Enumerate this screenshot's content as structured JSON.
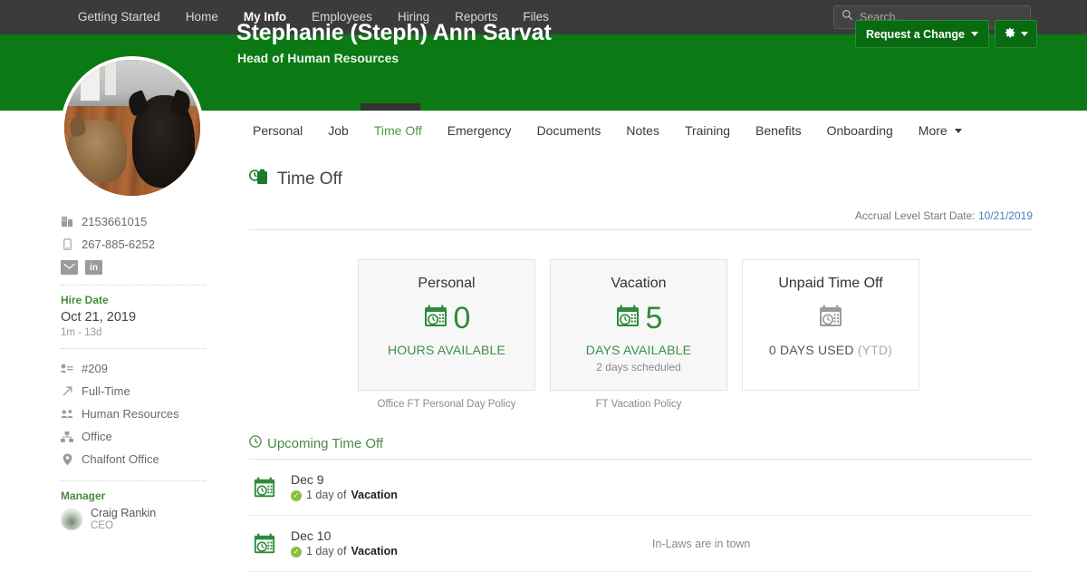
{
  "topnav": {
    "items": [
      {
        "label": "Getting Started",
        "active": false
      },
      {
        "label": "Home",
        "active": false
      },
      {
        "label": "My Info",
        "active": true
      },
      {
        "label": "Employees",
        "active": false
      },
      {
        "label": "Hiring",
        "active": false
      },
      {
        "label": "Reports",
        "active": false
      },
      {
        "label": "Files",
        "active": false
      }
    ],
    "search_placeholder": "Search..."
  },
  "header": {
    "employee_name": "Stephanie (Steph) Ann Sarvat",
    "employee_title": "Head of Human Resources",
    "request_change_label": "Request a Change",
    "accent_green": "#0b7a14"
  },
  "sidebar": {
    "work_phone": "2153661015",
    "mobile_phone": "267-885-6252",
    "email_icon_label": "✉",
    "linkedin_icon_label": "in",
    "hire_date_label": "Hire Date",
    "hire_date_value": "Oct 21, 2019",
    "hire_date_tenure": "1m - 13d",
    "employee_id": "#209",
    "employment_type": "Full-Time",
    "department": "Human Resources",
    "division": "Office",
    "location": "Chalfont Office",
    "manager_label": "Manager",
    "manager_name": "Craig Rankin",
    "manager_role": "CEO"
  },
  "tabs": [
    {
      "label": "Personal",
      "active": false,
      "caret": false
    },
    {
      "label": "Job",
      "active": false,
      "caret": false
    },
    {
      "label": "Time Off",
      "active": true,
      "caret": false
    },
    {
      "label": "Emergency",
      "active": false,
      "caret": false
    },
    {
      "label": "Documents",
      "active": false,
      "caret": false
    },
    {
      "label": "Notes",
      "active": false,
      "caret": false
    },
    {
      "label": "Training",
      "active": false,
      "caret": false
    },
    {
      "label": "Benefits",
      "active": false,
      "caret": false
    },
    {
      "label": "Onboarding",
      "active": false,
      "caret": false
    },
    {
      "label": "More",
      "active": false,
      "caret": true
    }
  ],
  "main": {
    "section_title": "Time Off",
    "accrual_label": "Accrual Level Start Date:",
    "accrual_date": "10/21/2019",
    "cards": [
      {
        "title": "Personal",
        "amount": "0",
        "unit": "HOURS AVAILABLE",
        "scheduled": "",
        "policy": "Office FT Personal Day Policy",
        "style": "filled"
      },
      {
        "title": "Vacation",
        "amount": "5",
        "unit": "DAYS AVAILABLE",
        "scheduled": "2 days scheduled",
        "policy": "FT Vacation Policy",
        "style": "filled"
      },
      {
        "title": "Unpaid Time Off",
        "amount": "",
        "unit": "0 DAYS USED",
        "unit_suffix": "(YTD)",
        "scheduled": "",
        "policy": "",
        "style": "plain"
      }
    ],
    "upcoming_title": "Upcoming Time Off",
    "upcoming": [
      {
        "date": "Dec 9",
        "amount": "1 day of",
        "type": "Vacation",
        "note": ""
      },
      {
        "date": "Dec 10",
        "amount": "1 day of",
        "type": "Vacation",
        "note": "In-Laws are in town"
      }
    ]
  }
}
